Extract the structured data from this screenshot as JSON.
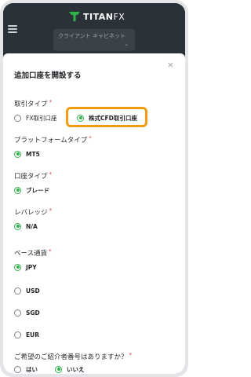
{
  "header": {
    "logo_text": "TITAN",
    "logo_suffix": "FX",
    "client_tab": "クライアント キャビネット"
  },
  "modal": {
    "title": "追加口座を開設する",
    "close_glyph": "×",
    "sections": {
      "account_type": {
        "label": "取引タイプ",
        "options": [
          "FX取引口座",
          "株式CFD取引口座"
        ],
        "selected": "株式CFD取引口座"
      },
      "platform": {
        "label": "プラットフォームタイプ",
        "options": [
          "MT5"
        ],
        "selected": "MT5"
      },
      "acct_kind": {
        "label": "口座タイプ",
        "options": [
          "ブレード"
        ],
        "selected": "ブレード"
      },
      "leverage": {
        "label": "レバレッジ",
        "options": [
          "N/A"
        ],
        "selected": "N/A"
      },
      "currency": {
        "label": "ベース通貨",
        "options": [
          "JPY",
          "USD",
          "SGD",
          "EUR"
        ],
        "selected": "JPY"
      },
      "referral": {
        "label": "ご希望のご紹介者番号はありますか？",
        "options": [
          "はい",
          "いいえ"
        ],
        "selected": "いいえ"
      }
    },
    "required_mark": "*"
  },
  "colors": {
    "accent_green": "#2fb34a",
    "highlight_orange": "#f39c12",
    "header_dark": "#2b3138"
  }
}
